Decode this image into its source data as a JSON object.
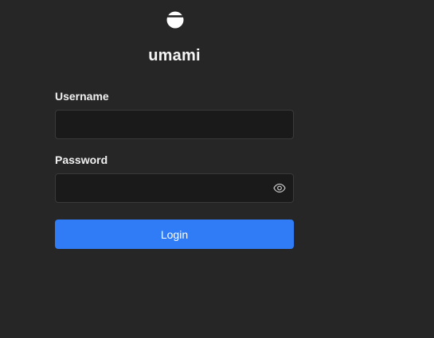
{
  "app": {
    "title": "umami",
    "logo_icon": "umami-logo-icon"
  },
  "login_form": {
    "username": {
      "label": "Username",
      "value": "",
      "placeholder": ""
    },
    "password": {
      "label": "Password",
      "value": "",
      "placeholder": "",
      "toggle_icon": "eye-icon"
    },
    "submit_label": "Login"
  },
  "colors": {
    "background": "#262626",
    "input_background": "#1a1a1a",
    "input_border": "#3a3a3a",
    "accent": "#2f7cf6",
    "text": "#f2f2f2"
  }
}
